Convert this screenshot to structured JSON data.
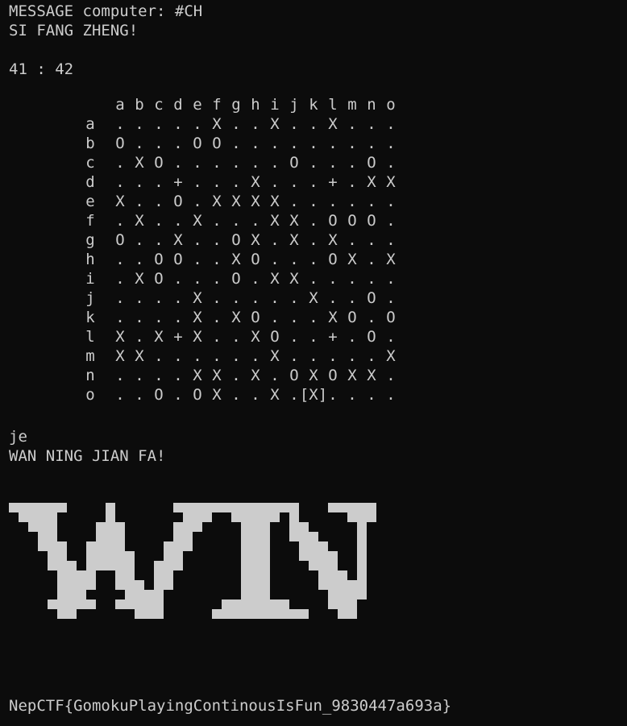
{
  "terminal": {
    "lines": {
      "message": "MESSAGE computer: #CH",
      "status1": "SI FANG ZHENG!",
      "score": "41 : 42",
      "move": "je",
      "status2": "WAN NING JIAN FA!",
      "flag": "NepCTF{GomokuPlayingContinousIsFun_9830447a693a}"
    }
  },
  "board": {
    "columns": [
      "a",
      "b",
      "c",
      "d",
      "e",
      "f",
      "g",
      "h",
      "i",
      "j",
      "k",
      "l",
      "m",
      "n",
      "o"
    ],
    "rows": [
      {
        "label": "a",
        "cells": [
          ".",
          ".",
          ".",
          ".",
          ".",
          "X",
          ".",
          ".",
          "X",
          ".",
          ".",
          "X",
          ".",
          ".",
          "."
        ]
      },
      {
        "label": "b",
        "cells": [
          "O",
          ".",
          ".",
          ".",
          "O",
          "O",
          ".",
          ".",
          ".",
          ".",
          ".",
          ".",
          ".",
          ".",
          "."
        ]
      },
      {
        "label": "c",
        "cells": [
          ".",
          "X",
          "O",
          ".",
          ".",
          ".",
          ".",
          ".",
          ".",
          "O",
          ".",
          ".",
          ".",
          "O",
          "."
        ]
      },
      {
        "label": "d",
        "cells": [
          ".",
          ".",
          ".",
          "+",
          ".",
          ".",
          ".",
          "X",
          ".",
          ".",
          ".",
          "+",
          ".",
          "X",
          "X"
        ]
      },
      {
        "label": "e",
        "cells": [
          "X",
          ".",
          ".",
          "O",
          ".",
          "X",
          "X",
          "X",
          "X",
          ".",
          ".",
          ".",
          ".",
          ".",
          "."
        ]
      },
      {
        "label": "f",
        "cells": [
          ".",
          "X",
          ".",
          ".",
          "X",
          ".",
          ".",
          ".",
          "X",
          "X",
          ".",
          "O",
          "O",
          "O",
          "."
        ]
      },
      {
        "label": "g",
        "cells": [
          "O",
          ".",
          ".",
          "X",
          ".",
          ".",
          "O",
          "X",
          ".",
          "X",
          ".",
          "X",
          ".",
          ".",
          "."
        ]
      },
      {
        "label": "h",
        "cells": [
          ".",
          ".",
          "O",
          "O",
          ".",
          ".",
          "X",
          "O",
          ".",
          ".",
          ".",
          "O",
          "X",
          ".",
          "X"
        ]
      },
      {
        "label": "i",
        "cells": [
          ".",
          "X",
          "O",
          ".",
          ".",
          ".",
          "O",
          ".",
          "X",
          "X",
          ".",
          ".",
          ".",
          ".",
          "."
        ]
      },
      {
        "label": "j",
        "cells": [
          ".",
          ".",
          ".",
          ".",
          "X",
          ".",
          ".",
          ".",
          ".",
          ".",
          "X",
          ".",
          ".",
          "O",
          "."
        ]
      },
      {
        "label": "k",
        "cells": [
          ".",
          ".",
          ".",
          ".",
          "X",
          ".",
          "X",
          "O",
          ".",
          ".",
          ".",
          "X",
          "O",
          ".",
          "O"
        ]
      },
      {
        "label": "l",
        "cells": [
          "X",
          ".",
          "X",
          "+",
          "X",
          ".",
          ".",
          "X",
          "O",
          ".",
          ".",
          "+",
          ".",
          "O",
          "."
        ]
      },
      {
        "label": "m",
        "cells": [
          "X",
          "X",
          ".",
          ".",
          ".",
          ".",
          ".",
          ".",
          "X",
          ".",
          ".",
          ".",
          ".",
          ".",
          "X"
        ]
      },
      {
        "label": "n",
        "cells": [
          ".",
          ".",
          ".",
          ".",
          "X",
          "X",
          ".",
          "X",
          ".",
          "O",
          "X",
          "O",
          "X",
          "X",
          "."
        ]
      },
      {
        "label": "o",
        "cells": [
          ".",
          ".",
          "O",
          ".",
          "O",
          "X",
          ".",
          ".",
          "X",
          ".",
          "[X]",
          ".",
          ".",
          ".",
          "."
        ]
      }
    ]
  },
  "banner": {
    "text": "WIN",
    "pixel_rows": [
      "xxxxxx....x......xxxxxxxxxxxxx...xxxxx",
      ".xxxx.....x.......xxx..xxxxx.x.....xxx.",
      "..xxx....xxx.....xxx....xxx..xx.....x..",
      "...xx....xxx.....xx.....xxx..xxx....x..",
      "...xxx..xxxx....xxx.....xxx...xxx...x..",
      "....xx..xxxxx...xx......xxx...xxxx..x..",
      "....xxx.xxxxx..xxx......xxx....xxx..x..",
      ".....xxxx..xx..xx.......xxx.....xxx.x..",
      ".....xxxx..xxx.xx.......xxx.....xxxxx..",
      ".....xxx....xxxx........xxx......xxxx..",
      "....xxxxx..xxxxx......xxxxxxx....xxx..",
      ".....xx......xxx.....xxxxxxxxxx...xx..",
      "..........................................",
      "..........................................."
    ]
  }
}
